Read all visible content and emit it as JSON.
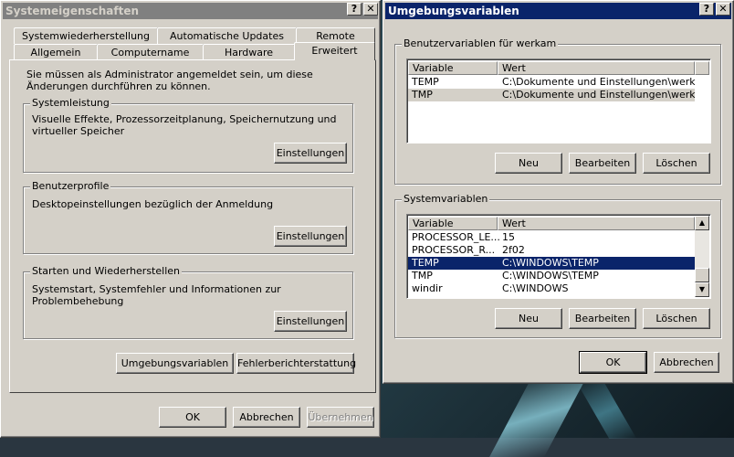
{
  "sysprops": {
    "title": "Systemeigenschaften",
    "help_btn": "?",
    "close_btn": "✕",
    "tabs_back": [
      "Systemwiederherstellung",
      "Automatische Updates",
      "Remote"
    ],
    "tabs_front": [
      "Allgemein",
      "Computername",
      "Hardware",
      "Erweitert"
    ],
    "admin_note": "Sie müssen als Administrator angemeldet sein, um diese Änderungen durchführen zu können.",
    "groups": [
      {
        "label": "Systemleistung",
        "desc": "Visuelle Effekte, Prozessorzeitplanung, Speichernutzung und virtueller Speicher",
        "button": "Einstellungen"
      },
      {
        "label": "Benutzerprofile",
        "desc": "Desktopeinstellungen bezüglich der Anmeldung",
        "button": "Einstellungen"
      },
      {
        "label": "Starten und Wiederherstellen",
        "desc": "Systemstart, Systemfehler und Informationen zur Problembehebung",
        "button": "Einstellungen"
      }
    ],
    "env_button": "Umgebungsvariablen",
    "error_button": "Fehlerberichterstattung",
    "ok": "OK",
    "cancel": "Abbrechen",
    "apply": "Übernehmen"
  },
  "envvars": {
    "title": "Umgebungsvariablen",
    "help_btn": "?",
    "close_btn": "✕",
    "user_group": "Benutzervariablen für werkam",
    "sys_group": "Systemvariablen",
    "col_var": "Variable",
    "col_val": "Wert",
    "user_rows": [
      {
        "var": "TEMP",
        "val": "C:\\Dokumente und Einstellungen\\werka..."
      },
      {
        "var": "TMP",
        "val": "C:\\Dokumente und Einstellungen\\werka..."
      }
    ],
    "sys_rows": [
      {
        "var": "PROCESSOR_LE...",
        "val": "15"
      },
      {
        "var": "PROCESSOR_R...",
        "val": "2f02"
      },
      {
        "var": "TEMP",
        "val": "C:\\WINDOWS\\TEMP"
      },
      {
        "var": "TMP",
        "val": "C:\\WINDOWS\\TEMP"
      },
      {
        "var": "windir",
        "val": "C:\\WINDOWS"
      }
    ],
    "new": "Neu",
    "edit": "Bearbeiten",
    "delete": "Löschen",
    "ok": "OK",
    "cancel": "Abbrechen",
    "scroll_up": "▲",
    "scroll_down": "▼"
  }
}
